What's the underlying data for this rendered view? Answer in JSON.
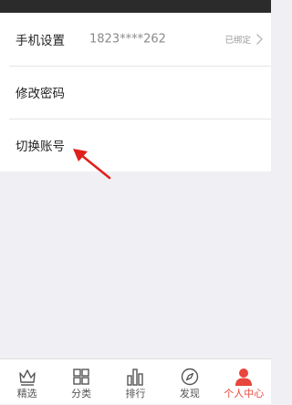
{
  "rows": [
    {
      "label": "手机设置",
      "value": "1823****262",
      "status": "已绑定"
    },
    {
      "label": "修改密码"
    },
    {
      "label": "切换账号"
    }
  ],
  "tabs": [
    {
      "label": "精选",
      "icon": "crown-icon"
    },
    {
      "label": "分类",
      "icon": "grid-icon"
    },
    {
      "label": "排行",
      "icon": "bar-chart-icon"
    },
    {
      "label": "发现",
      "icon": "compass-icon"
    },
    {
      "label": "个人中心",
      "icon": "user-icon",
      "active": true
    }
  ],
  "colors": {
    "accent": "#e8453c",
    "background": "#efeff4",
    "status_bar": "#2b2b2b",
    "annotation_arrow": "#e0201b"
  }
}
